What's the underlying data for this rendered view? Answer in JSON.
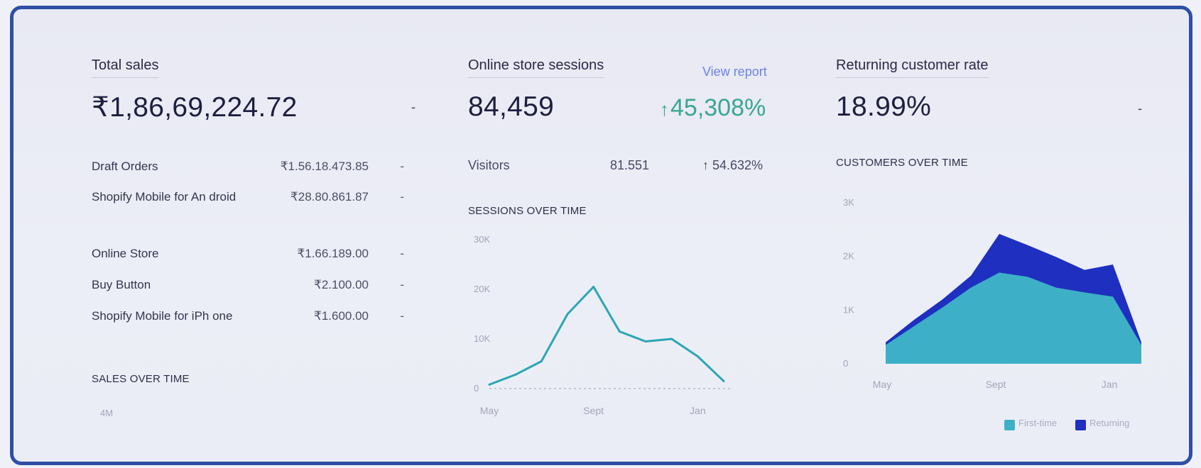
{
  "total_sales": {
    "title": "Total sales",
    "value": "₹1,86,69,224.72",
    "dash": "-",
    "channels": [
      {
        "label": "Draft Orders",
        "amount": "₹1.56.18.473.85",
        "dash": "-"
      },
      {
        "label": "Shopify Mobile for An droid",
        "amount": "₹28.80.861.87",
        "dash": "-"
      },
      {
        "label": "Online Store",
        "amount": "₹1.66.189.00",
        "dash": "-"
      },
      {
        "label": "Buy Button",
        "amount": "₹2.100.00",
        "dash": "-"
      },
      {
        "label": "Shopify Mobile for iPh one",
        "amount": "₹1.600.00",
        "dash": "-"
      }
    ],
    "section_title": "SALES OVER TIME",
    "y_tick": "4M"
  },
  "sessions": {
    "title": "Online store sessions",
    "link": "View report",
    "value": "84,459",
    "delta": "45,308%",
    "delta_arrow": "↑",
    "visitors_label": "Visitors",
    "visitors_value": "81.551",
    "visitors_delta": "↑ 54.632%",
    "section_title": "SESSIONS OVER TIME",
    "line_color": "#2aa6b4"
  },
  "returning": {
    "title": "Returning customer rate",
    "value": "18.99%",
    "dash": "-",
    "section_title": "CUSTOMERS OVER TIME",
    "first_color": "#3db0c8",
    "returning_color": "#1f2fc0"
  },
  "chart_data": [
    {
      "type": "line",
      "ylim": [
        0,
        30000
      ],
      "y_ticks": [
        "30K",
        "20K",
        "10K",
        "0"
      ],
      "x_tick_labels": [
        "May",
        "Sept",
        "Jan"
      ],
      "x": [
        "May",
        "Jun",
        "Jul",
        "Aug",
        "Sept",
        "Oct",
        "Nov",
        "Dec",
        "Jan",
        "Feb"
      ],
      "values": [
        800,
        2800,
        5500,
        15000,
        20500,
        11500,
        9500,
        10000,
        6500,
        1500
      ]
    },
    {
      "type": "area",
      "ylim": [
        0,
        3000
      ],
      "y_ticks": [
        "3K",
        "2K",
        "1K",
        "0"
      ],
      "x_tick_labels": [
        "May",
        "Sept",
        "Jan"
      ],
      "x": [
        "May",
        "Jun",
        "Jul",
        "Aug",
        "Sept",
        "Oct",
        "Nov",
        "Dec",
        "Jan",
        "Feb"
      ],
      "series": [
        {
          "name": "First-time",
          "values": [
            350,
            700,
            1050,
            1420,
            1700,
            1620,
            1420,
            1330,
            1250,
            350
          ]
        },
        {
          "name": "Returning",
          "values": [
            50,
            120,
            150,
            220,
            720,
            590,
            570,
            420,
            600,
            50
          ]
        }
      ]
    }
  ]
}
